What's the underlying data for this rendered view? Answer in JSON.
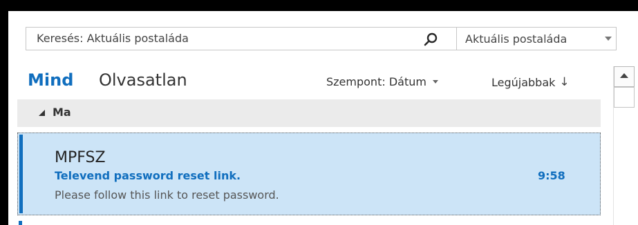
{
  "search": {
    "placeholder": "Keresés: Aktuális postaláda",
    "scope_value": "Aktuális postaláda"
  },
  "filters": {
    "all": "Mind",
    "unread": "Olvasatlan"
  },
  "sort": {
    "by_label": "Szempont: Dátum",
    "order_label": "Legújabbak",
    "order_arrow": "↓"
  },
  "groups": [
    {
      "label": "Ma",
      "messages": [
        {
          "sender": "MPFSZ",
          "subject": "Televend password reset link.",
          "time": "9:58",
          "preview": "Please follow this link to reset password."
        }
      ]
    }
  ],
  "colors": {
    "accent": "#106ebe",
    "selected_bg": "#cce4f7",
    "group_bg": "#ebebeb"
  },
  "icons": {
    "search": "search-icon",
    "scope_dropdown": "chevron-down-icon",
    "sort_dropdown": "caret-down-icon",
    "group_toggle": "collapse-triangle-icon",
    "scroll_up": "scroll-up-arrow-icon"
  }
}
